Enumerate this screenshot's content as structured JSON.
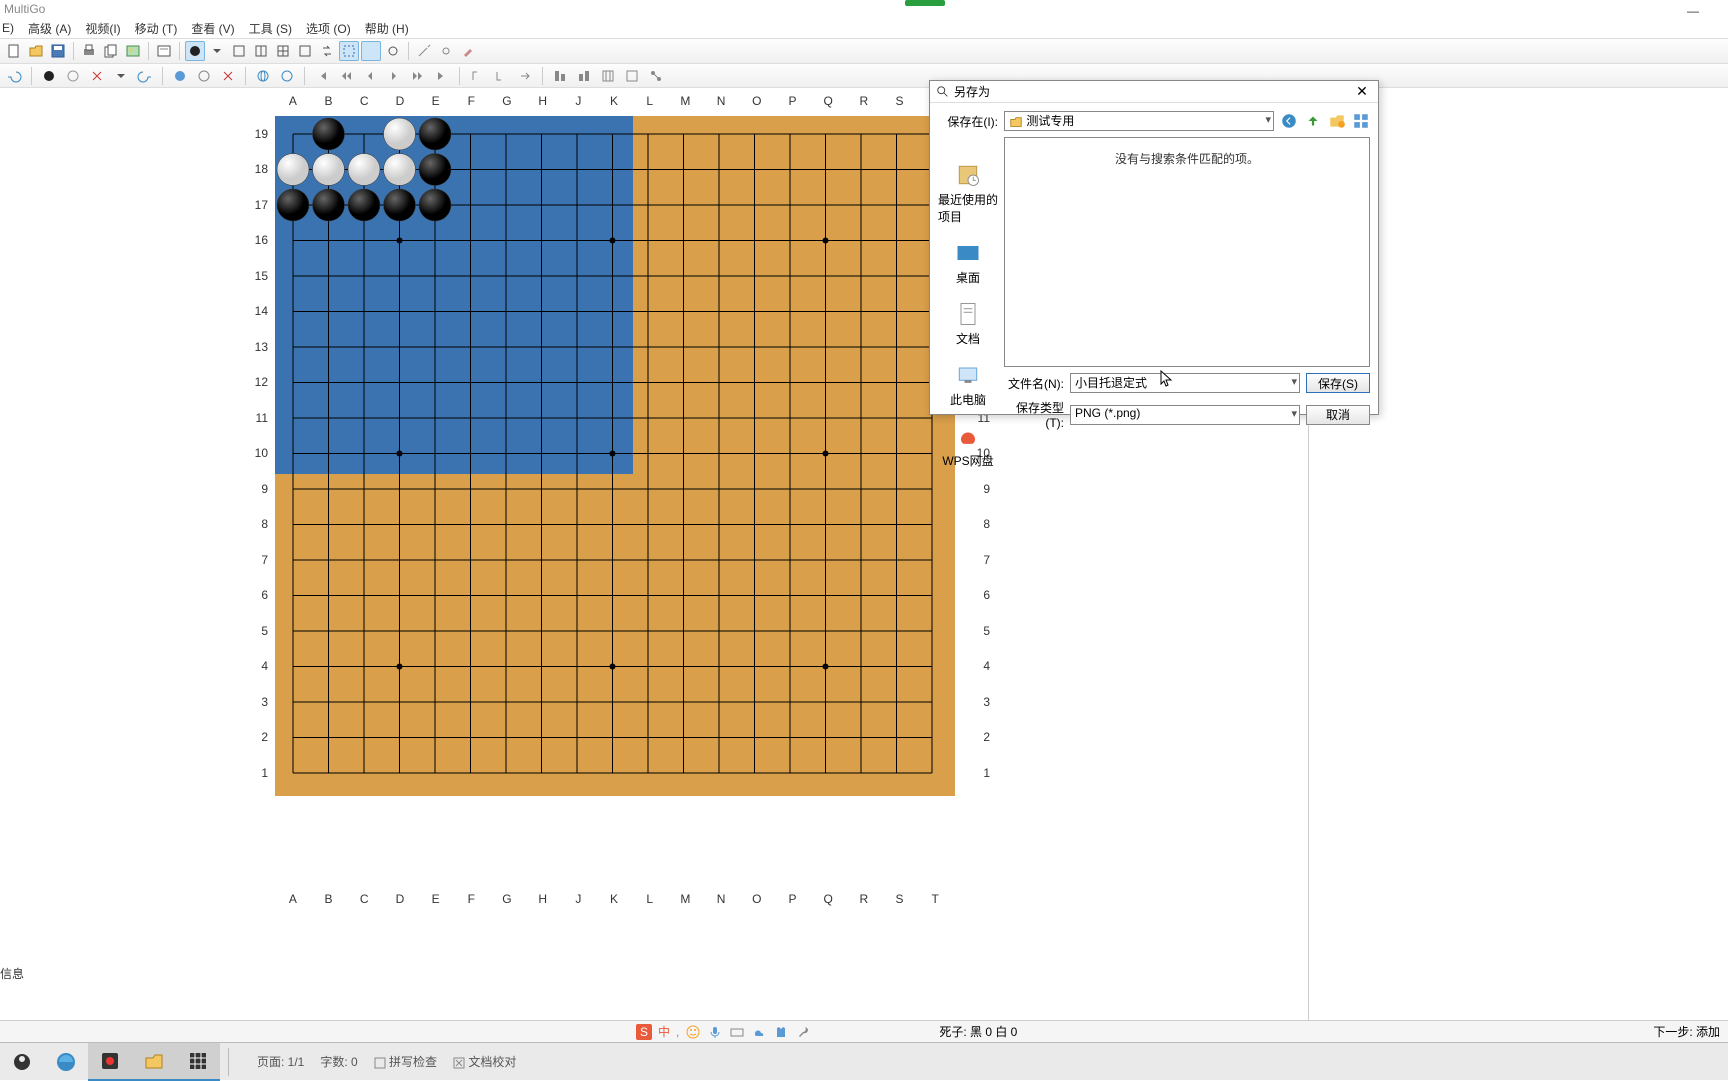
{
  "app_title": "MultiGo",
  "menu": {
    "e": "E)",
    "adv": "高级 (A)",
    "video": "视频(I)",
    "move": "移动 (T)",
    "view": "查看 (V)",
    "tools": "工具 (S)",
    "option": "选项 (O)",
    "help": "帮助 (H)"
  },
  "board": {
    "cols": [
      "A",
      "B",
      "C",
      "D",
      "E",
      "F",
      "G",
      "H",
      "J",
      "K",
      "L",
      "M",
      "N",
      "O",
      "P",
      "Q",
      "R",
      "S",
      "T"
    ],
    "rows": [
      "19",
      "18",
      "17",
      "16",
      "15",
      "14",
      "13",
      "12",
      "11",
      "10",
      "9",
      "8",
      "7",
      "6",
      "5",
      "4",
      "3",
      "2",
      "1"
    ]
  },
  "dialog": {
    "title": "另存为",
    "save_in_label": "保存在(I):",
    "save_in_value": "测试专用",
    "empty_msg": "没有与搜索条件匹配的项。",
    "side": {
      "recent": "最近使用的项目",
      "desktop": "桌面",
      "docs": "文档",
      "pc": "此电脑",
      "wps": "WPS网盘"
    },
    "fname_label": "文件名(N):",
    "fname_value": "小目托退定式",
    "ftype_label": "保存类型(T):",
    "ftype_value": "PNG (*.png)",
    "save_btn": "保存(S)",
    "cancel_btn": "取消"
  },
  "status": {
    "info": "信息",
    "captured": "死子: 黑 0 白 0",
    "next": "下一步: 添加"
  },
  "taskbar": {
    "page": "页面: 1/1",
    "words": "字数: 0",
    "spell": "拼写检查",
    "proof": "文档校对"
  },
  "tray": {
    "ime": "中"
  }
}
